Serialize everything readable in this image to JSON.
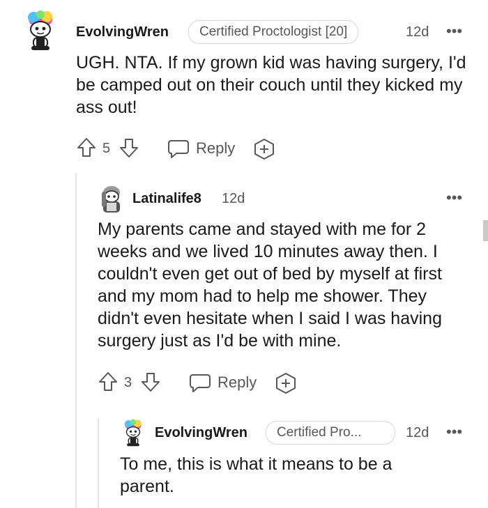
{
  "comments": [
    {
      "username": "EvolvingWren",
      "flair": "Certified Proctologist [20]",
      "age": "12d",
      "body": "UGH. NTA. If my grown kid was having surgery, I'd be camped out on their couch until they kicked my ass out!",
      "votes": "5",
      "reply_label": "Reply",
      "avatar_icon": "snoo-rainbow-hair-avatar"
    },
    {
      "username": "Latinalife8",
      "age": "12d",
      "body": "My parents came and stayed with me for 2 weeks and we lived 10 minutes away then. I couldn't even get out of bed by myself at first and my mom had to help me shower. They didn't even hesitate when I said I was having surgery just as I'd be with mine.",
      "votes": "3",
      "reply_label": "Reply",
      "avatar_icon": "snoo-gray-hair-avatar"
    },
    {
      "username": "EvolvingWren",
      "flair": "Certified Pro...",
      "age": "12d",
      "body": "To me, this is what it means to be a parent.",
      "avatar_icon": "snoo-rainbow-hair-avatar"
    }
  ],
  "more_glyph": "•••",
  "colors": {
    "text": "#1a1a1b",
    "meta": "#575757",
    "flair_border": "#d7d7d7",
    "thread_line": "#e6e6e6"
  }
}
